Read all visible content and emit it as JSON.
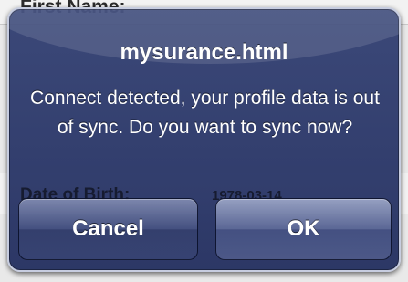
{
  "background_form": {
    "row1_label": "First Name:",
    "row2_label": "Date of Birth:",
    "row2_value": "1978-03-14"
  },
  "alert": {
    "title": "mysurance.html",
    "message": "Connect detected, your profile data is out of sync. Do you want to sync now?",
    "cancel_label": "Cancel",
    "ok_label": "OK"
  },
  "colors": {
    "alert_background": "#22305f",
    "alert_border": "#c7cde0",
    "text": "#ffffff"
  }
}
